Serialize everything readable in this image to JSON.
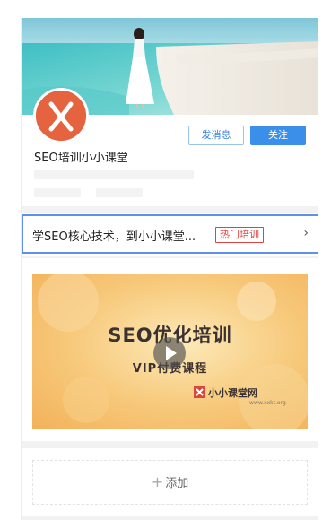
{
  "profile": {
    "name": "SEO培训小小课堂",
    "message_button": "发消息",
    "follow_button": "关注"
  },
  "promo": {
    "text": "学SEO核心技术，到小小课堂...",
    "tag": "热门培训",
    "arrow": "›"
  },
  "video": {
    "title": "SEO优化培训",
    "subtitle": "VIP付费课程",
    "brand": "小小课堂网",
    "brand_url": "www.xxkt.org"
  },
  "add": {
    "plus": "+",
    "label": "添加"
  },
  "colors": {
    "accent": "#3a8fe8",
    "tag_red": "#e0433f",
    "promo_border": "#5f8ff2"
  }
}
